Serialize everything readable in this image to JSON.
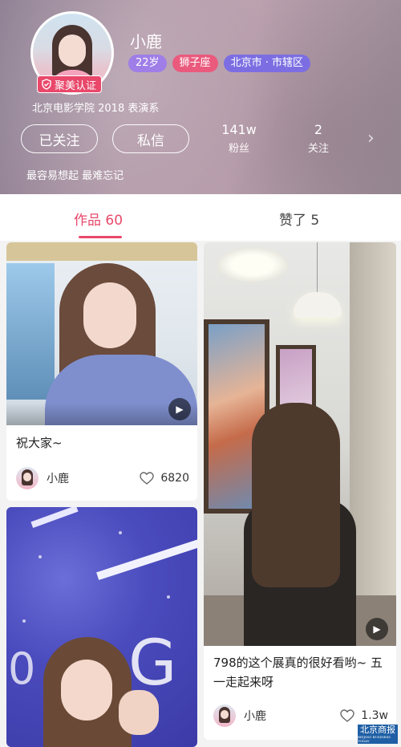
{
  "profile": {
    "name": "小鹿",
    "certification": "聚美认证",
    "tags": {
      "age": "22岁",
      "zodiac": "狮子座",
      "location": "北京市 · 市辖区"
    },
    "school": "北京电影学院 2018 表演系",
    "buttons": {
      "follow": "已关注",
      "message": "私信"
    },
    "stats": {
      "fans_count": "141w",
      "fans_label": "粉丝",
      "following_count": "2",
      "following_label": "关注"
    },
    "bio": "最容易想起 最难忘记"
  },
  "tabs": {
    "works": "作品 60",
    "likes": "赞了 5"
  },
  "feed": [
    {
      "caption": "祝大家~",
      "author": "小鹿",
      "likes": "6820"
    },
    {
      "caption": "798的这个展真的很好看哟~ 五一走起来呀",
      "author": "小鹿",
      "likes": "1.3w"
    }
  ],
  "watermark": {
    "line1": "北京商报",
    "line2": "BEIJING BUSINESS TODAY"
  },
  "colors": {
    "accent": "#e9486b",
    "age_tag": "#9f7ee8",
    "zodiac_tag": "#ea5a7d",
    "location_tag": "#7c6ee2"
  }
}
